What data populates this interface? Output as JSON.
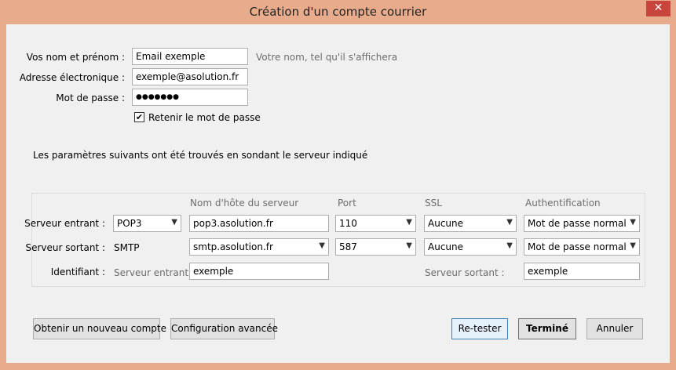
{
  "window": {
    "title": "Création d'un compte courrier",
    "close_symbol": "✕"
  },
  "account": {
    "name_label": "Vos nom et prénom :",
    "name_value": "Email exemple",
    "name_hint": "Votre nom, tel qu'il s'affichera",
    "email_label": "Adresse électronique :",
    "email_value": "exemple@asolution.fr",
    "password_label": "Mot de passe :",
    "password_value": "●●●●●●●",
    "remember_label": "Retenir le mot de passe",
    "remember_checked": true
  },
  "info_text": "Les paramètres suivants ont été trouvés en sondant le serveur indiqué",
  "server": {
    "headers": {
      "hostname": "Nom d'hôte du serveur",
      "port": "Port",
      "ssl": "SSL",
      "auth": "Authentification"
    },
    "incoming": {
      "label": "Serveur entrant :",
      "protocol": "POP3",
      "hostname": "pop3.asolution.fr",
      "port": "110",
      "ssl": "Aucune",
      "auth": "Mot de passe normal"
    },
    "outgoing": {
      "label": "Serveur sortant :",
      "protocol": "SMTP",
      "hostname": "smtp.asolution.fr",
      "port": "587",
      "ssl": "Aucune",
      "auth": "Mot de passe normal"
    },
    "identifier": {
      "label": "Identifiant :",
      "incoming_label": "Serveur entrant :",
      "incoming_value": "exemple",
      "outgoing_label": "Serveur sortant :",
      "outgoing_value": "exemple"
    }
  },
  "buttons": {
    "new_account": "Obtenir un nouveau compte",
    "advanced": "Configuration avancée",
    "retest": "Re-tester",
    "done": "Terminé",
    "cancel": "Annuler"
  }
}
